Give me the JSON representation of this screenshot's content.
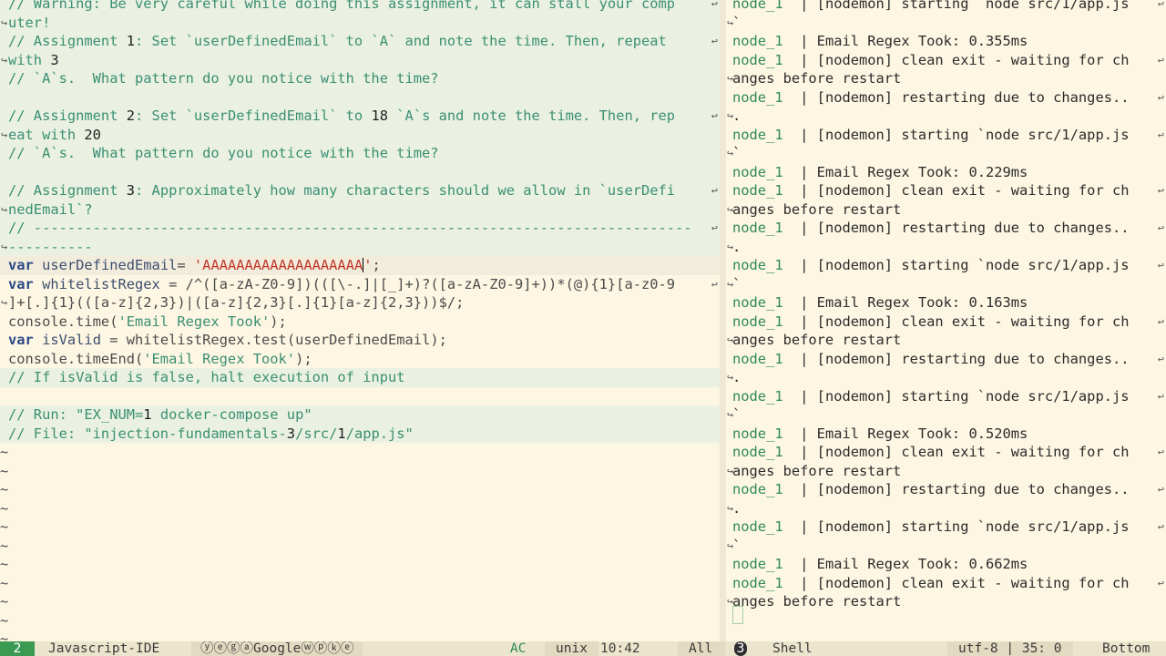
{
  "editor": {
    "lines": [
      {
        "type": "comment",
        "text": "// Warning: Be very careful while doing this assignment, it can stall your comp",
        "wrap_r": true
      },
      {
        "type": "comment",
        "text": "uter!",
        "wrap_l": true
      },
      {
        "type": "comment",
        "text": "// Assignment 1: Set `userDefinedEmail` to `A` and note the time. Then, repeat",
        "wrap_r": true
      },
      {
        "type": "comment",
        "text": "with 3",
        "wrap_l": true
      },
      {
        "type": "comment",
        "text": "// `A`s.  What pattern do you notice with the time?"
      },
      {
        "type": "comment",
        "text": ""
      },
      {
        "type": "comment",
        "text": "// Assignment 2: Set `userDefinedEmail` to 18 `A`s and note the time. Then, rep",
        "wrap_r": true
      },
      {
        "type": "comment",
        "text": "eat with 20",
        "wrap_l": true
      },
      {
        "type": "comment",
        "text": "// `A`s.  What pattern do you notice with the time?"
      },
      {
        "type": "comment",
        "text": ""
      },
      {
        "type": "comment",
        "text": "// Assignment 3: Approximately how many characters should we allow in `userDefi",
        "wrap_r": true
      },
      {
        "type": "comment",
        "text": "nedEmail`?",
        "wrap_l": true
      },
      {
        "type": "comment",
        "text": "// ------------------------------------------------------------------------------",
        "wrap_r": true
      },
      {
        "type": "comment",
        "text": "----------",
        "wrap_l": true
      },
      {
        "type": "code",
        "text": "var userDefinedEmail= 'AAAAAAAAAAAAAAAAAAA';"
      },
      {
        "type": "code",
        "text": "var whitelistRegex = /^([a-zA-Z0-9])(([\\-.]|[_]+)?([a-zA-Z0-9]+))*(@){1}[a-z0-9",
        "wrap_r": true
      },
      {
        "type": "code",
        "text": "]+[.]{1}(([a-z]{2,3})|([a-z]{2,3}[.]{1}[a-z]{2,3}))$/;",
        "wrap_l": true
      },
      {
        "type": "code",
        "text": "console.time('Email Regex Took');"
      },
      {
        "type": "code",
        "text": "var isValid = whitelistRegex.test(userDefinedEmail);"
      },
      {
        "type": "code",
        "text": "console.timeEnd('Email Regex Took');"
      },
      {
        "type": "comment",
        "text": "// If isValid is false, halt execution of input"
      },
      {
        "type": "code",
        "text": ""
      },
      {
        "type": "comment",
        "text": "// Run: \"EX_NUM=1 docker-compose up\""
      },
      {
        "type": "comment",
        "text": "// File: \"injection-fundamentals-3/src/1/app.js\""
      }
    ],
    "tildes": [
      "~",
      "~",
      "~",
      "~",
      "~",
      "~",
      "~",
      "~",
      "~",
      "~",
      "~"
    ]
  },
  "shell": {
    "lines": [
      {
        "text": "node_1  | [nodemon] starting `node src/1/app.js",
        "wrap_r": true
      },
      {
        "text": "`",
        "wrap_l": true
      },
      {
        "text": "node_1  | Email Regex Took: 0.355ms"
      },
      {
        "text": "node_1  | [nodemon] clean exit - waiting for ch",
        "wrap_r": true
      },
      {
        "text": "anges before restart",
        "wrap_l": true
      },
      {
        "text": "node_1  | [nodemon] restarting due to changes..",
        "wrap_r": true
      },
      {
        "text": ".",
        "wrap_l": true
      },
      {
        "text": "node_1  | [nodemon] starting `node src/1/app.js",
        "wrap_r": true
      },
      {
        "text": "`",
        "wrap_l": true
      },
      {
        "text": "node_1  | Email Regex Took: 0.229ms"
      },
      {
        "text": "node_1  | [nodemon] clean exit - waiting for ch",
        "wrap_r": true
      },
      {
        "text": "anges before restart",
        "wrap_l": true
      },
      {
        "text": "node_1  | [nodemon] restarting due to changes..",
        "wrap_r": true
      },
      {
        "text": ".",
        "wrap_l": true
      },
      {
        "text": "node_1  | [nodemon] starting `node src/1/app.js",
        "wrap_r": true
      },
      {
        "text": "`",
        "wrap_l": true
      },
      {
        "text": "node_1  | Email Regex Took: 0.163ms"
      },
      {
        "text": "node_1  | [nodemon] clean exit - waiting for ch",
        "wrap_r": true
      },
      {
        "text": "anges before restart",
        "wrap_l": true
      },
      {
        "text": "node_1  | [nodemon] restarting due to changes..",
        "wrap_r": true
      },
      {
        "text": ".",
        "wrap_l": true
      },
      {
        "text": "node_1  | [nodemon] starting `node src/1/app.js",
        "wrap_r": true
      },
      {
        "text": "`",
        "wrap_l": true
      },
      {
        "text": "node_1  | Email Regex Took: 0.520ms"
      },
      {
        "text": "node_1  | [nodemon] clean exit - waiting for ch",
        "wrap_r": true
      },
      {
        "text": "anges before restart",
        "wrap_l": true
      },
      {
        "text": "node_1  | [nodemon] restarting due to changes..",
        "wrap_r": true
      },
      {
        "text": ".",
        "wrap_l": true
      },
      {
        "text": "node_1  | [nodemon] starting `node src/1/app.js",
        "wrap_r": true
      },
      {
        "text": "`",
        "wrap_l": true
      },
      {
        "text": "node_1  | Email Regex Took: 0.662ms"
      },
      {
        "text": "node_1  | [nodemon] clean exit - waiting for ch",
        "wrap_r": true
      },
      {
        "text": "anges before restart",
        "wrap_l": true
      }
    ]
  },
  "modeline": {
    "left_badge": "2",
    "left_mode": "Javascript-IDE",
    "left_minor": "ⓨⓔⓖⓐGoogleⓦⓟⓚⓔ",
    "left_ac": "AC",
    "left_eol": "unix",
    "left_pos": "10:42",
    "left_scroll": "All",
    "right_badge": "3",
    "right_mode": "Shell",
    "right_enc": "utf-8 | 35: 0",
    "right_scroll": "Bottom"
  },
  "colors": {
    "background": "#fdf6e3",
    "comment": "#3a8f72",
    "keyword": "#2a4a86",
    "string": "#c0392b",
    "node": "#2f8a56",
    "badge": "#3a9a52"
  }
}
